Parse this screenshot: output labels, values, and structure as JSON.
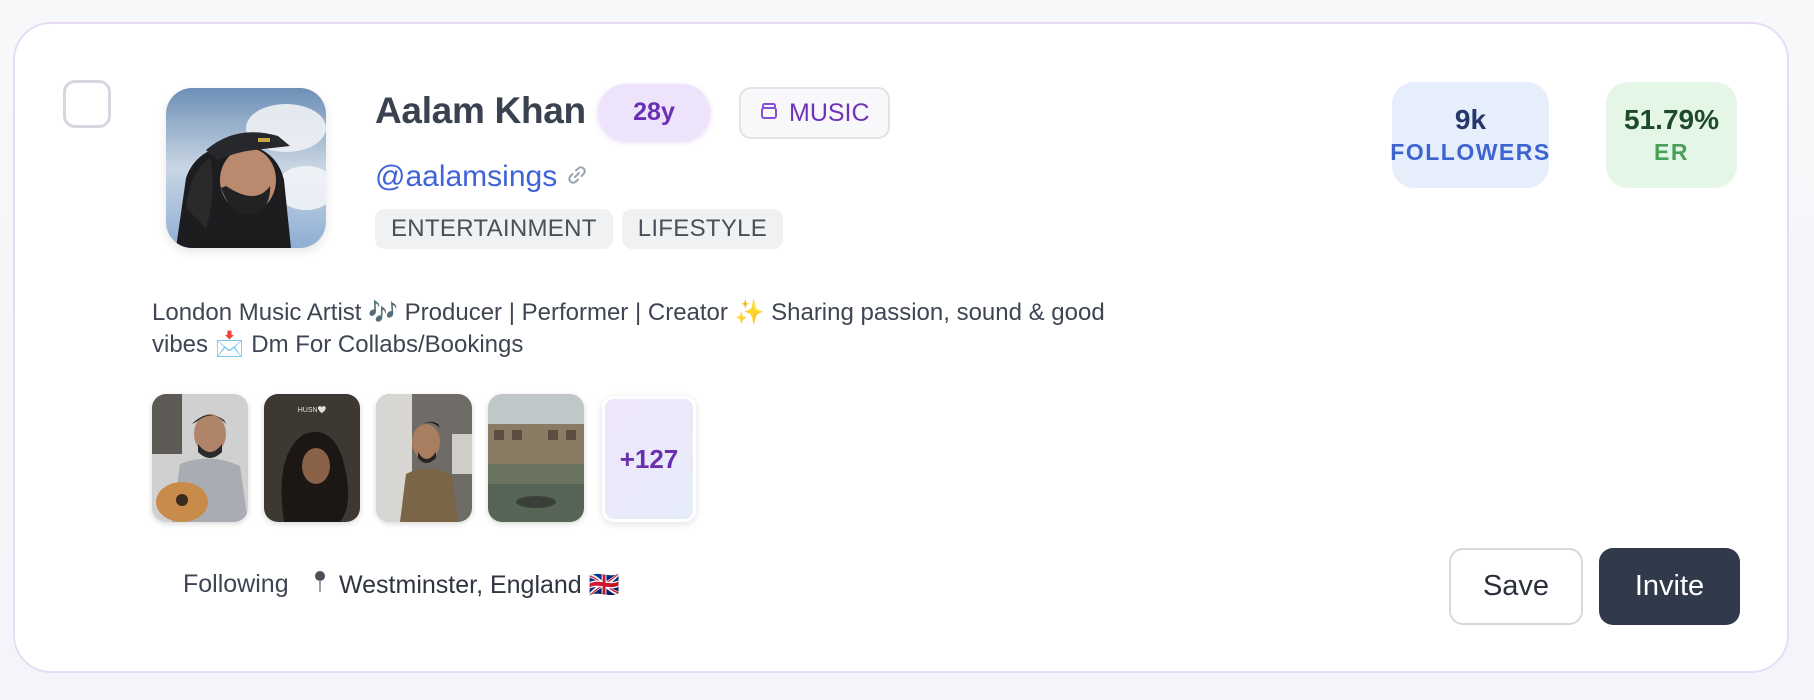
{
  "profile": {
    "name": "Aalam Khan",
    "age": "28y",
    "category": "MUSIC",
    "handle": "@aalamsings",
    "tags": [
      "ENTERTAINMENT",
      "LIFESTYLE"
    ],
    "bio": "London Music Artist 🎶 Producer | Performer | Creator ✨ Sharing passion, sound & good vibes 📩 Dm For Collabs/Bookings",
    "following_status": "Following",
    "location": "Westminster, England 🇬🇧"
  },
  "stats": {
    "followers": {
      "value": "9k",
      "label": "FOLLOWERS"
    },
    "er": {
      "value": "51.79%",
      "label": "ER"
    }
  },
  "posts": {
    "more_count": "+127",
    "thumbnails": [
      {
        "icon": "guitar-player-photo"
      },
      {
        "icon": "long-hair-portrait-photo",
        "caption": "HUSN🤍"
      },
      {
        "icon": "profile-window-photo"
      },
      {
        "icon": "canal-town-photo"
      }
    ]
  },
  "actions": {
    "save_label": "Save",
    "invite_label": "Invite"
  },
  "icons": {
    "category": "cube-icon",
    "handle_link": "link-icon",
    "location": "pin-icon"
  },
  "colors": {
    "accent_purple": "#6e33b8",
    "handle_blue": "#3f63d9",
    "followers_bg": "#e6eefc",
    "er_bg": "#e4f7e7",
    "invite_bg": "#313a4b"
  }
}
